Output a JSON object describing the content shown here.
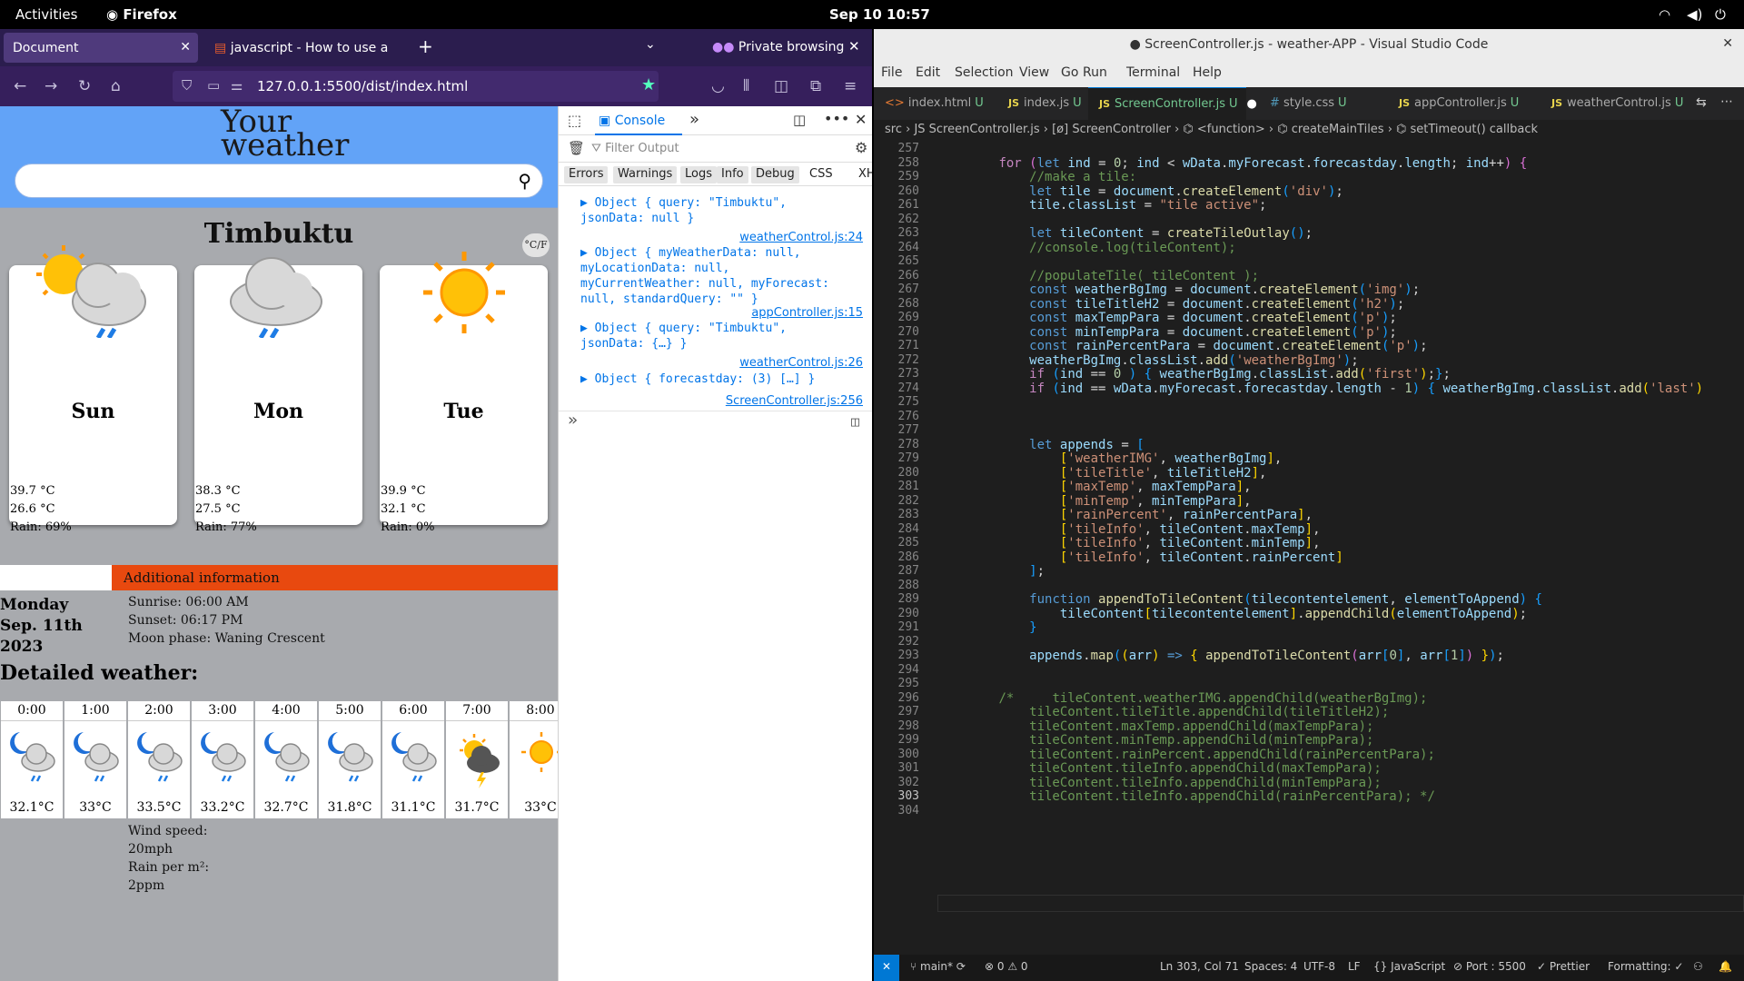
{
  "gnome": {
    "activities": "Activities",
    "app": "Firefox",
    "clock": "Sep 10  10:57"
  },
  "firefox": {
    "tabs": [
      {
        "label": "Document"
      },
      {
        "label": "javascript - How to use a f"
      }
    ],
    "private_label": "Private browsing",
    "url": "127.0.0.1:5500/dist/index.html"
  },
  "weather": {
    "logo_line1": "Your",
    "logo_line2": "weather",
    "search_value": "",
    "city": "Timbuktu",
    "unit_toggle": "°C/F",
    "days": [
      {
        "name": "Sun",
        "max": "39.7 °C",
        "min": "26.6 °C",
        "rain": "Rain: 69%",
        "icon": "sun-cloud-rain-icon"
      },
      {
        "name": "Mon",
        "max": "38.3 °C",
        "min": "27.5 °C",
        "rain": "Rain: 77%",
        "icon": "cloud-rain-icon"
      },
      {
        "name": "Tue",
        "max": "39.9 °C",
        "min": "32.1 °C",
        "rain": "Rain: 0%",
        "icon": "sun-icon"
      }
    ],
    "additional_title": "Additional information",
    "date": "Monday Sep. 11th 2023",
    "sunrise": "Sunrise: 06:00 AM",
    "sunset": "Sunset: 06:17 PM",
    "moon": "Moon phase: Waning Crescent",
    "detailed_title": "Detailed weather:",
    "hours": [
      {
        "time": "0:00",
        "temp": "32.1°C",
        "icon": "moon-cloud-rain-icon"
      },
      {
        "time": "1:00",
        "temp": "33°C",
        "icon": "moon-cloud-rain-icon"
      },
      {
        "time": "2:00",
        "temp": "33.5°C",
        "icon": "moon-cloud-rain-icon"
      },
      {
        "time": "3:00",
        "temp": "33.2°C",
        "icon": "moon-cloud-rain-icon"
      },
      {
        "time": "4:00",
        "temp": "32.7°C",
        "icon": "moon-cloud-rain-icon"
      },
      {
        "time": "5:00",
        "temp": "31.8°C",
        "icon": "moon-cloud-rain-icon"
      },
      {
        "time": "6:00",
        "temp": "31.1°C",
        "icon": "moon-cloud-rain-icon"
      },
      {
        "time": "7:00",
        "temp": "31.7°C",
        "icon": "sun-storm-icon"
      },
      {
        "time": "8:00",
        "temp": "33°C",
        "icon": "sun-icon"
      }
    ],
    "wind_label": "Wind speed:",
    "wind_value": "20mph",
    "rain_label": "Rain per m²:",
    "rain_value": "2ppm"
  },
  "devtools": {
    "console_tab": "Console",
    "filter_placeholder": "Filter Output",
    "levels": [
      "Errors",
      "Warnings",
      "Logs",
      "Info",
      "Debug"
    ],
    "css": "CSS",
    "xhr": "XH",
    "logs": [
      {
        "text": "▶ Object { query: \"Timbuktu\", jsonData: null }",
        "source": "weatherControl.js:24"
      },
      {
        "text": "▶ Object { myWeatherData: null, myLocationData: null, myCurrentWeather: null, myForecast: null, standardQuery: \"\" }",
        "source": "appController.js:15"
      },
      {
        "text": "▶ Object { query: \"Timbuktu\", jsonData: {…} }",
        "source": "weatherControl.js:26"
      },
      {
        "text": "▶ Object { forecastday: (3) […] }",
        "source": "ScreenController.js:256"
      }
    ],
    "prompt": "»"
  },
  "vscode": {
    "title": "● ScreenController.js - weather-APP - Visual Studio Code",
    "menu": [
      "File",
      "Edit",
      "Selection",
      "View",
      "Go",
      "Run",
      "Terminal",
      "Help"
    ],
    "tabs": [
      {
        "label": "index.html",
        "type": "<>"
      },
      {
        "label": "index.js",
        "type": "JS"
      },
      {
        "label": "ScreenController.js",
        "type": "JS"
      },
      {
        "label": "style.css",
        "type": "#"
      },
      {
        "label": "appController.js",
        "type": "JS"
      },
      {
        "label": "weatherControl.js",
        "type": "JS"
      }
    ],
    "tab_status": "U",
    "breadcrumb": "src  ›  JS ScreenController.js  ›  [ø] ScreenController  ›  ⌬ <function>  ›  ⌬ createMainTiles  ›  ⌬ setTimeout() callback",
    "status": {
      "branch": "main*",
      "errors": "⊗ 0 ⚠ 0",
      "pos": "Ln 303, Col 71",
      "spaces": "Spaces: 4",
      "enc": "UTF-8",
      "eol": "LF",
      "lang": "{} JavaScript",
      "port": "⊘ Port : 5500",
      "prettier": "✓ Prettier",
      "formatting": "Formatting: ✓"
    },
    "lines": [
      {
        "n": "257",
        "html": ""
      },
      {
        "n": "258",
        "html": "        <span class='kp'>for</span> <span class='br2'>(</span><span class='kw'>let</span> <span class='var'>ind</span> = <span class='num'>0</span>; <span class='var'>ind</span> &lt; <span class='var'>wData</span>.<span class='var'>myForecast</span>.<span class='var'>forecastday</span>.<span class='var'>length</span>; <span class='var'>ind</span>++<span class='br2'>)</span> <span class='br2'>{</span>"
      },
      {
        "n": "259",
        "html": "            <span class='cm'>//make a tile:</span>"
      },
      {
        "n": "260",
        "html": "            <span class='kw'>let</span> <span class='var'>tile</span> = <span class='var'>document</span>.<span class='fn'>createElement</span><span class='br3'>(</span><span class='str'>'div'</span><span class='br3'>)</span>;"
      },
      {
        "n": "261",
        "html": "            <span class='var'>tile</span>.<span class='var'>classList</span> = <span class='str'>\"tile active\"</span>;"
      },
      {
        "n": "262",
        "html": ""
      },
      {
        "n": "263",
        "html": "            <span class='kw'>let</span> <span class='var'>tileContent</span> = <span class='fn'>createTileOutlay</span><span class='br3'>()</span>;"
      },
      {
        "n": "264",
        "html": "            <span class='cm'>//console.log(tileContent);</span>"
      },
      {
        "n": "265",
        "html": ""
      },
      {
        "n": "266",
        "html": "            <span class='cm'>//populateTile( tileContent );</span>"
      },
      {
        "n": "267",
        "html": "            <span class='kw'>const</span> <span class='var'>weatherBgImg</span> = <span class='var'>document</span>.<span class='fn'>createElement</span><span class='br3'>(</span><span class='str'>'img'</span><span class='br3'>)</span>;"
      },
      {
        "n": "268",
        "html": "            <span class='kw'>const</span> <span class='var'>tileTitleH2</span> = <span class='var'>document</span>.<span class='fn'>createElement</span><span class='br3'>(</span><span class='str'>'h2'</span><span class='br3'>)</span>;"
      },
      {
        "n": "269",
        "html": "            <span class='kw'>const</span> <span class='var'>maxTempPara</span> = <span class='var'>document</span>.<span class='fn'>createElement</span><span class='br3'>(</span><span class='str'>'p'</span><span class='br3'>)</span>;"
      },
      {
        "n": "270",
        "html": "            <span class='kw'>const</span> <span class='var'>minTempPara</span> = <span class='var'>document</span>.<span class='fn'>createElement</span><span class='br3'>(</span><span class='str'>'p'</span><span class='br3'>)</span>;"
      },
      {
        "n": "271",
        "html": "            <span class='kw'>const</span> <span class='var'>rainPercentPara</span> = <span class='var'>document</span>.<span class='fn'>createElement</span><span class='br3'>(</span><span class='str'>'p'</span><span class='br3'>)</span>;"
      },
      {
        "n": "272",
        "html": "            <span class='var'>weatherBgImg</span>.<span class='var'>classList</span>.<span class='fn'>add</span><span class='br3'>(</span><span class='str'>'weatherBgImg'</span><span class='br3'>)</span>;"
      },
      {
        "n": "273",
        "html": "            <span class='kp'>if</span> <span class='br3'>(</span><span class='var'>ind</span> == <span class='num'>0</span> <span class='br3'>)</span> <span class='br3'>{</span> <span class='var'>weatherBgImg</span>.<span class='var'>classList</span>.<span class='fn'>add</span><span class='br1'>(</span><span class='str'>'first'</span><span class='br1'>)</span>;<span class='br3'>}</span>;"
      },
      {
        "n": "274",
        "html": "            <span class='kp'>if</span> <span class='br3'>(</span><span class='var'>ind</span> == <span class='var'>wData</span>.<span class='var'>myForecast</span>.<span class='var'>forecastday</span>.<span class='var'>length</span> - <span class='num'>1</span><span class='br3'>)</span> <span class='br3'>{</span> <span class='var'>weatherBgImg</span>.<span class='var'>classList</span>.<span class='fn'>add</span><span class='br1'>(</span><span class='str'>'last'</span><span class='br1'>)</span>"
      },
      {
        "n": "275",
        "html": ""
      },
      {
        "n": "276",
        "html": ""
      },
      {
        "n": "277",
        "html": ""
      },
      {
        "n": "278",
        "html": "            <span class='kw'>let</span> <span class='var'>appends</span> = <span class='br3'>[</span>"
      },
      {
        "n": "279",
        "html": "                <span class='br1'>[</span><span class='str'>'weatherIMG'</span>, <span class='var'>weatherBgImg</span><span class='br1'>]</span>,"
      },
      {
        "n": "280",
        "html": "                <span class='br1'>[</span><span class='str'>'tileTitle'</span>, <span class='var'>tileTitleH2</span><span class='br1'>]</span>,"
      },
      {
        "n": "281",
        "html": "                <span class='br1'>[</span><span class='str'>'maxTemp'</span>, <span class='var'>maxTempPara</span><span class='br1'>]</span>,"
      },
      {
        "n": "282",
        "html": "                <span class='br1'>[</span><span class='str'>'minTemp'</span>, <span class='var'>minTempPara</span><span class='br1'>]</span>,"
      },
      {
        "n": "283",
        "html": "                <span class='br1'>[</span><span class='str'>'rainPercent'</span>, <span class='var'>rainPercentPara</span><span class='br1'>]</span>,"
      },
      {
        "n": "284",
        "html": "                <span class='br1'>[</span><span class='str'>'tileInfo'</span>, <span class='var'>tileContent</span>.<span class='var'>maxTemp</span><span class='br1'>]</span>,"
      },
      {
        "n": "285",
        "html": "                <span class='br1'>[</span><span class='str'>'tileInfo'</span>, <span class='var'>tileContent</span>.<span class='var'>minTemp</span><span class='br1'>]</span>,"
      },
      {
        "n": "286",
        "html": "                <span class='br1'>[</span><span class='str'>'tileInfo'</span>, <span class='var'>tileContent</span>.<span class='var'>rainPercent</span><span class='br1'>]</span>"
      },
      {
        "n": "287",
        "html": "            <span class='br3'>]</span>;"
      },
      {
        "n": "288",
        "html": ""
      },
      {
        "n": "289",
        "html": "            <span class='kw'>function</span> <span class='fn'>appendToTileContent</span><span class='br3'>(</span><span class='var'>tilecontentelement</span>, <span class='var'>elementToAppend</span><span class='br3'>)</span> <span class='br3'>{</span>"
      },
      {
        "n": "290",
        "html": "                <span class='var'>tileContent</span><span class='br1'>[</span><span class='var'>tilecontentelement</span><span class='br1'>]</span>.<span class='fn'>appendChild</span><span class='br1'>(</span><span class='var'>elementToAppend</span><span class='br1'>)</span>;"
      },
      {
        "n": "291",
        "html": "            <span class='br3'>}</span>"
      },
      {
        "n": "292",
        "html": ""
      },
      {
        "n": "293",
        "html": "            <span class='var'>appends</span>.<span class='fn'>map</span><span class='br3'>(</span><span class='br1'>(</span><span class='var'>arr</span><span class='br1'>)</span> <span class='kw'>=&gt;</span> <span class='br1'>{</span> <span class='fn'>appendToTileContent</span><span class='br2'>(</span><span class='var'>arr</span><span class='br3'>[</span><span class='num'>0</span><span class='br3'>]</span>, <span class='var'>arr</span><span class='br3'>[</span><span class='num'>1</span><span class='br3'>]</span><span class='br2'>)</span> <span class='br1'>}</span><span class='br3'>)</span>;"
      },
      {
        "n": "294",
        "html": ""
      },
      {
        "n": "295",
        "html": ""
      },
      {
        "n": "296",
        "html": "        <span class='cm'>/*     tileContent.weatherIMG.appendChild(weatherBgImg);</span>"
      },
      {
        "n": "297",
        "html": "<span class='cm'>            tileContent.tileTitle.appendChild(tileTitleH2);</span>"
      },
      {
        "n": "298",
        "html": "<span class='cm'>            tileContent.maxTemp.appendChild(maxTempPara);</span>"
      },
      {
        "n": "299",
        "html": "<span class='cm'>            tileContent.minTemp.appendChild(minTempPara);</span>"
      },
      {
        "n": "300",
        "html": "<span class='cm'>            tileContent.rainPercent.appendChild(rainPercentPara);</span>"
      },
      {
        "n": "301",
        "html": "<span class='cm'>            tileContent.tileInfo.appendChild(maxTempPara);</span>"
      },
      {
        "n": "302",
        "html": "<span class='cm'>            tileContent.tileInfo.appendChild(minTempPara);</span>"
      },
      {
        "n": "303",
        "html": "<span class='cm'>            tileContent.tileInfo.appendChild(rainPercentPara); */</span>"
      },
      {
        "n": "304",
        "html": ""
      }
    ]
  }
}
